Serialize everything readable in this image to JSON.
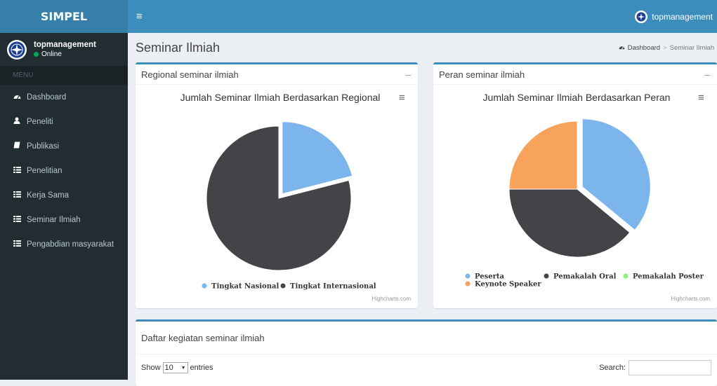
{
  "header": {
    "brand": "SIMPEL",
    "username": "topmanagement"
  },
  "sidebar": {
    "user": {
      "name": "topmanagement",
      "status": "Online"
    },
    "menu_header": "MENU",
    "items": [
      {
        "label": "Dashboard",
        "icon": "dashboard-icon"
      },
      {
        "label": "Peneliti",
        "icon": "user-icon"
      },
      {
        "label": "Publikasi",
        "icon": "book-icon"
      },
      {
        "label": "Penelitian",
        "icon": "list-icon"
      },
      {
        "label": "Kerja Sama",
        "icon": "list-icon"
      },
      {
        "label": "Seminar Ilmiah",
        "icon": "list-icon"
      },
      {
        "label": "Pengabdian masyarakat",
        "icon": "list-icon"
      }
    ]
  },
  "content": {
    "title": "Seminar Ilmiah",
    "breadcrumb": [
      "Dashboard",
      "Seminar Ilmiah"
    ],
    "regional_box": {
      "title": "Regional seminar ilmiah",
      "credits": "Highcharts.com"
    },
    "peran_box": {
      "title": "Peran seminar ilmiah",
      "credits": "Highcharts.com"
    },
    "table_box": {
      "title": "Daftar kegiatan seminar ilmiah",
      "show_label": "Show",
      "entries_value": "10",
      "entries_label": "entries",
      "search_label": "Search:"
    }
  },
  "colors": {
    "blue": "#7cb5ec",
    "dark": "#434348",
    "green": "#90ed7d",
    "orange": "#f7a35c",
    "accent": "#3c8dbc"
  },
  "chart_data": [
    {
      "type": "pie",
      "title": "Jumlah Seminar Ilmiah Berdasarkan Regional",
      "series": [
        {
          "name": "Tingkat Nasional",
          "value": 21,
          "color": "#7cb5ec"
        },
        {
          "name": "Tingkat Internasional",
          "value": 79,
          "color": "#434348"
        }
      ],
      "legend": "bottom-center"
    },
    {
      "type": "pie",
      "title": "Jumlah Seminar Ilmiah Berdasarkan Peran",
      "series": [
        {
          "name": "Peserta",
          "value": 36,
          "color": "#7cb5ec"
        },
        {
          "name": "Pemakalah Oral",
          "value": 39,
          "color": "#434348"
        },
        {
          "name": "Pemakalah Poster",
          "value": 0,
          "color": "#90ed7d"
        },
        {
          "name": "Keynote Speaker",
          "value": 25,
          "color": "#f7a35c"
        }
      ],
      "legend": "bottom-left"
    }
  ]
}
